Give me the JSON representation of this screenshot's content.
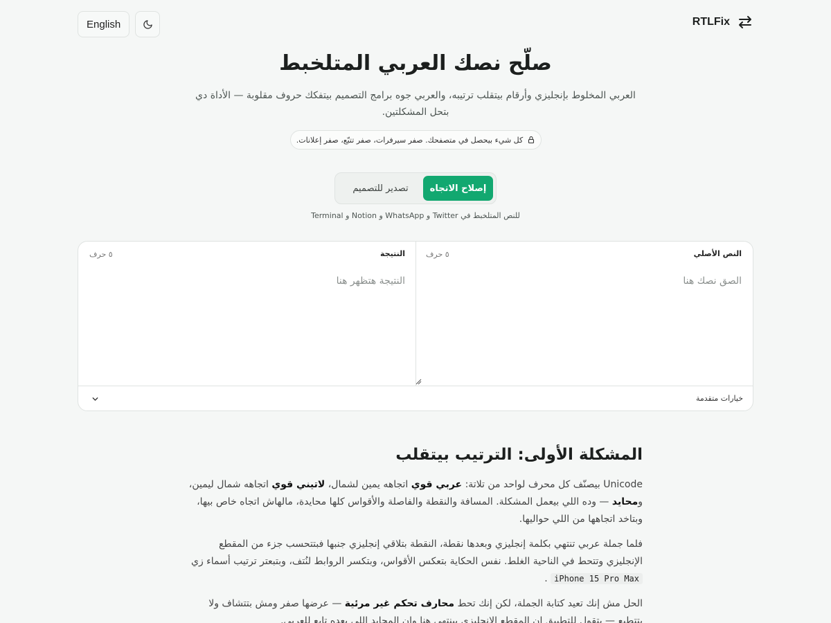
{
  "header": {
    "brand": "RTLFix",
    "language_button": "English",
    "theme_icon": "moon-icon",
    "brand_icon": "swap-arrows-icon"
  },
  "hero": {
    "title": "صلّح نصك العربي المتلخبط",
    "subtitle": "العربي المخلوط بإنجليزي وأرقام بيتقلب ترتيبه، والعربي جوه برامج التصميم بيتفكك حروف مقلوبة — الأداة دي بتحل المشكلتين.",
    "privacy": "كل شيء بيحصل في متصفحك. صفر سيرفرات، صفر تتبّع، صفر إعلانات."
  },
  "tabs": {
    "active": "إصلاح الاتجاه",
    "other": "تصدير للتصميم"
  },
  "hint": "للنص المتلخبط في Twitter و WhatsApp و Notion و Terminal",
  "editor": {
    "input": {
      "label": "النص الأصلي",
      "count": "٥ حرف",
      "placeholder": "الصق نصك هنا"
    },
    "output": {
      "label": "النتيجة",
      "count": "٥ حرف",
      "placeholder": "النتيجة هتظهر هنا"
    },
    "advanced": "خيارات متقدمة"
  },
  "article": {
    "heading": "المشكلة الأولى: الترتيب بيتقلب",
    "p1": {
      "a": "Unicode بيصنّف كل محرف لواحد من تلاتة: ",
      "b1": "عربي قوي",
      "c": " اتجاهه يمين لشمال، ",
      "b2": "لاتيني قوي",
      "d": " اتجاهه شمال ليمين، و",
      "b3": "محايد",
      "e": " — وده اللي بيعمل المشكلة. المسافة والنقطة والفاصلة والأقواس كلها محايدة، مالهاش اتجاه خاص بيها، وبتاخد اتجاهها من اللي حواليها."
    },
    "p2": {
      "a": "فلما جملة عربي تنتهي بكلمة إنجليزي وبعدها نقطة، النقطة بتلاقي إنجليزي جنبها فبتتحسب جزء من المقطع الإنجليزي وتتحط في الناحية الغلط. نفس الحكاية بتعكس الأقواس، وبتكسر الروابط لنُتف، وبتبعتر ترتيب أسماء زي ",
      "code": "iPhone 15 Pro Max",
      "b": " ."
    },
    "p3": {
      "a": "الحل مش إنك تعيد كتابة الجملة، لكن إنك تحط ",
      "b1": "محارف تحكم غير مرئية",
      "c": " — عرضها صفر ومش بتتشاف ولا بتتطبع — بتقول للتطبيق إن المقطع الإنجليزي بينتهي هنا وإن المحايد اللي بعده تابع للعربي."
    }
  },
  "colors": {
    "accent": "#12a870",
    "background": "#f5f7f6"
  }
}
